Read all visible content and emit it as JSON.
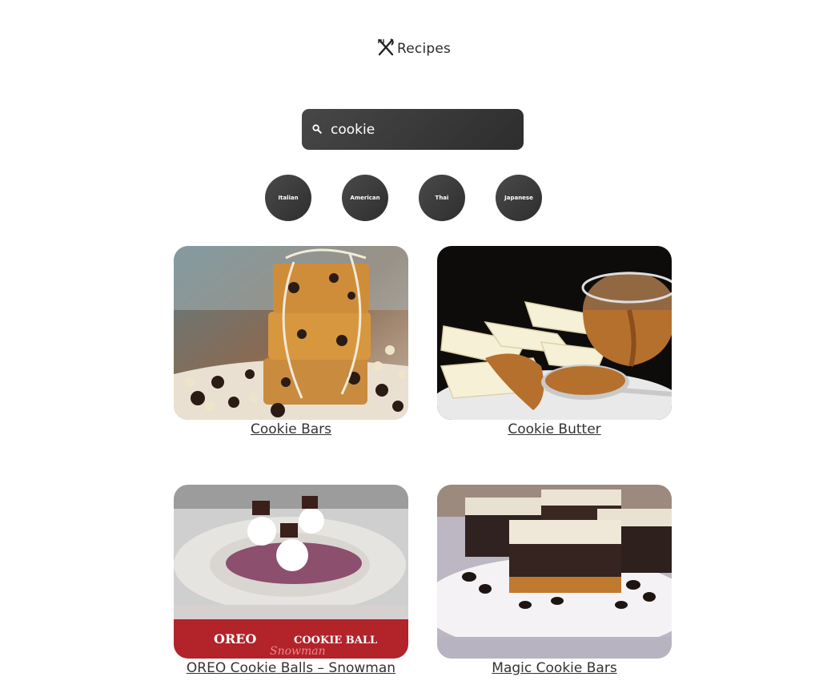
{
  "header": {
    "title": "Recipes",
    "icon": "utensils-icon"
  },
  "search": {
    "value": "cookie",
    "icon": "search-icon"
  },
  "cuisines": [
    "Italian",
    "American",
    "Thai",
    "Japanese"
  ],
  "recipes": [
    {
      "title": "Cookie Bars",
      "image": "cookie-bars-photo"
    },
    {
      "title": "Cookie Butter",
      "image": "cookie-butter-photo"
    },
    {
      "title": "OREO Cookie Balls – Snowman",
      "image": "oreo-snowman-photo",
      "image_caption_a": "OREO",
      "image_caption_b": "COOKIE BALL",
      "image_caption_c": "Snowman"
    },
    {
      "title": "Magic Cookie Bars",
      "image": "magic-cookie-bars-photo"
    }
  ],
  "colors": {
    "accent": "#3a3a3a",
    "text": "#333333",
    "background": "#ffffff"
  }
}
